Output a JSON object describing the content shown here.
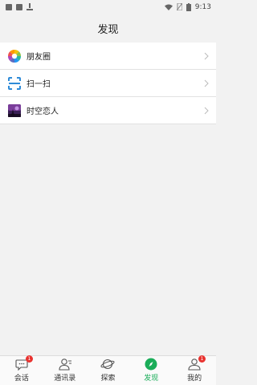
{
  "status": {
    "time": "9:13",
    "icons": [
      "notification-square-icon",
      "notification-square-icon",
      "download-icon",
      "wifi-icon",
      "no-sim-icon",
      "battery-icon"
    ]
  },
  "header": {
    "title": "发现"
  },
  "list": [
    {
      "label": "朋友圈",
      "icon": "moments-icon"
    },
    {
      "label": "扫一扫",
      "icon": "scan-icon"
    },
    {
      "label": "时空恋人",
      "icon": "app-thumbnail-icon"
    }
  ],
  "tabs": [
    {
      "label": "会话",
      "icon": "chat-icon",
      "badge": "1"
    },
    {
      "label": "通讯录",
      "icon": "contacts-icon"
    },
    {
      "label": "探索",
      "icon": "planet-icon"
    },
    {
      "label": "发现",
      "icon": "compass-icon"
    },
    {
      "label": "我的",
      "icon": "profile-icon",
      "badge": "1"
    }
  ],
  "colors": {
    "accent": "#1aad59",
    "badge": "#e9322f"
  }
}
